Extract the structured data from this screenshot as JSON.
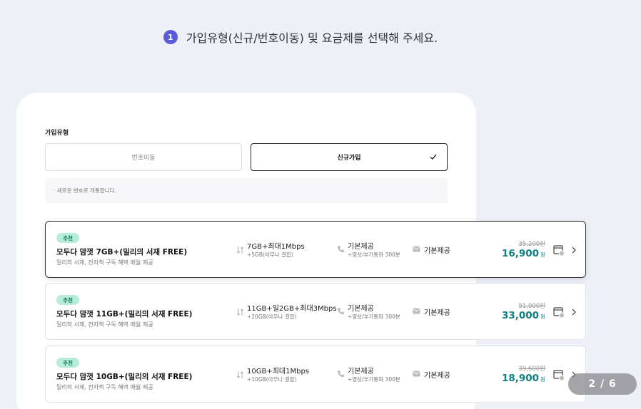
{
  "header": {
    "step_number": "1",
    "title": "가입유형(신규/번호이동) 및 요금제를 선택해 주세요."
  },
  "join_type": {
    "label": "가입유형",
    "options": [
      {
        "label": "번호이동",
        "selected": false
      },
      {
        "label": "신규가입",
        "selected": true
      }
    ],
    "notice": "· 새로운 번호로 개통합니다."
  },
  "plans": [
    {
      "badge": "추천",
      "name": "모두다 맘껏 7GB+(밀리의 서재 FREE)",
      "desc": "밀리의 서재, 전자책 구독 혜택 매월 제공",
      "data_main": "7GB+최대1Mbps",
      "data_sub": "+5GB(아무나 결합)",
      "call_main": "기본제공",
      "call_sub": "+영상/부가통화 300분",
      "sms_main": "기본제공",
      "orig_price": "35,200원",
      "price": "16,900",
      "won": "원"
    },
    {
      "badge": "추천",
      "name": "모두다 맘껏 11GB+(밀리의 서재 FREE)",
      "desc": "밀리의 서재, 전자책 구독 혜택 매월 제공",
      "data_main": "11GB+일2GB+최대3Mbps",
      "data_sub": "+20GB(아무나 결합)",
      "call_main": "기본제공",
      "call_sub": "+영상/부가통화 300분",
      "sms_main": "기본제공",
      "orig_price": "51,000원",
      "price": "33,000",
      "won": "원"
    },
    {
      "badge": "추천",
      "name": "모두다 맘껏 10GB+(밀리의 서재 FREE)",
      "desc": "밀리의 서재, 전자책 구독 혜택 매월 제공",
      "data_main": "10GB+최대1Mbps",
      "data_sub": "+10GB(아무나 결합)",
      "call_main": "기본제공",
      "call_sub": "+영상/부가통화 300분",
      "sms_main": "기본제공",
      "orig_price": "39,600원",
      "price": "18,900",
      "won": "원"
    }
  ],
  "pager": "2 / 6",
  "colors": {
    "accent": "#5b5bd6",
    "price": "#0f7f83",
    "badge_bg": "#b6ecd9"
  }
}
